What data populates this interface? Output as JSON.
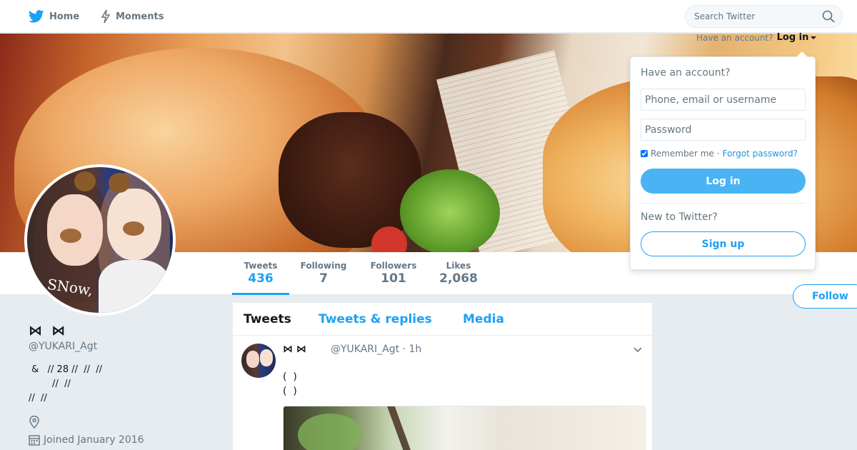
{
  "nav": {
    "home_label": "Home",
    "moments_label": "Moments",
    "home_icon": "twitter-bird-icon",
    "moments_icon": "lightning-icon"
  },
  "search": {
    "placeholder": "Search Twitter",
    "icon": "search-icon"
  },
  "login_toggle": {
    "prompt": "Have an account?",
    "link": "Log in"
  },
  "login_dropdown": {
    "title": "Have an account?",
    "username_placeholder": "Phone, email or username",
    "password_placeholder": "Password",
    "remember_label": "Remember me",
    "separator": "·",
    "forgot_label": "Forgot password?",
    "login_button": "Log in",
    "new_prompt": "New to Twitter?",
    "signup_button": "Sign up"
  },
  "profile": {
    "name": "⋈ ︎︎︎︎︎ ⋈",
    "handle": "@YUKARI_Agt",
    "bio": " &   // 28 //  //  //\n        //  //\n//  //",
    "location_icon": "map-pin-icon",
    "joined_icon": "calendar-icon",
    "joined": "Joined January 2016",
    "follow_button": "Follow"
  },
  "stats": {
    "tweets_label": "Tweets",
    "tweets_value": "436",
    "following_label": "Following",
    "following_value": "7",
    "followers_label": "Followers",
    "followers_value": "101",
    "likes_label": "Likes",
    "likes_value": "2,068"
  },
  "timeline": {
    "tabs": [
      "Tweets",
      "Tweets & replies",
      "Media"
    ],
    "tweet": {
      "name": "⋈  ⋈",
      "handle_time": "@YUKARI_Agt · 1h",
      "text": "(  )\n(  )",
      "menu_icon": "chevron-down-icon"
    }
  },
  "colors": {
    "accent": "#1da1f2",
    "background": "#e6ecf0",
    "login_button": "#4ab3f4"
  }
}
